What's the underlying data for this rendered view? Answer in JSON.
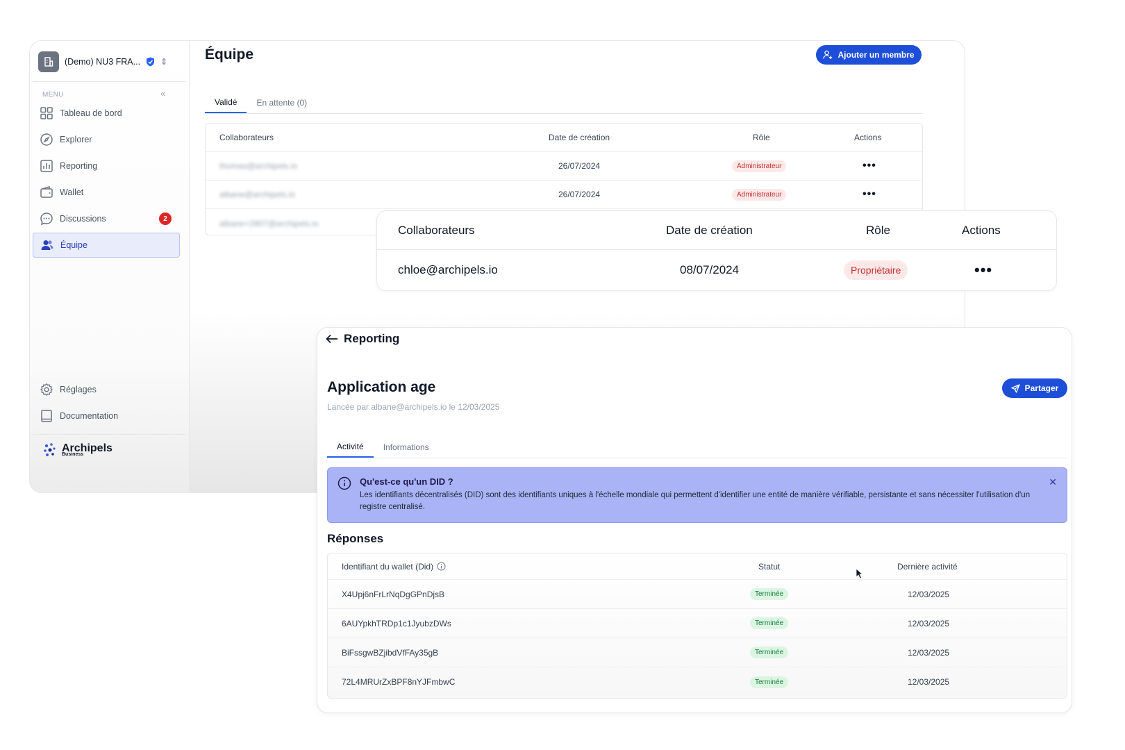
{
  "sidebar": {
    "org_name": "(Demo) NU3 FRA...",
    "menu_label": "MENU",
    "items": [
      {
        "label": "Tableau de bord",
        "icon": "dashboard-icon"
      },
      {
        "label": "Explorer",
        "icon": "compass-icon"
      },
      {
        "label": "Reporting",
        "icon": "chart-icon"
      },
      {
        "label": "Wallet",
        "icon": "wallet-icon"
      },
      {
        "label": "Discussions",
        "icon": "chat-icon",
        "badge": "2"
      },
      {
        "label": "Équipe",
        "icon": "users-icon",
        "active": true
      }
    ],
    "bottom_items": [
      {
        "label": "Réglages",
        "icon": "gear-icon"
      },
      {
        "label": "Documentation",
        "icon": "book-icon"
      }
    ],
    "brand": {
      "name": "Archipels",
      "sub": "Business"
    }
  },
  "team": {
    "title": "Équipe",
    "add_button": "Ajouter un membre",
    "tabs": [
      "Validé",
      "En attente (0)"
    ],
    "columns": [
      "Collaborateurs",
      "Date de création",
      "Rôle",
      "Actions"
    ],
    "rows": [
      {
        "email": "thomas@archipels.io",
        "date": "26/07/2024",
        "role": "Administrateur"
      },
      {
        "email": "albane@archipels.io",
        "date": "26/07/2024",
        "role": "Administrateur"
      },
      {
        "email": "albane+2807@archipels.io",
        "date": "",
        "role": ""
      }
    ]
  },
  "owner_card": {
    "columns": [
      "Collaborateurs",
      "Date de création",
      "Rôle",
      "Actions"
    ],
    "email": "chloe@archipels.io",
    "date": "08/07/2024",
    "role": "Propriétaire"
  },
  "report": {
    "back_label": "Reporting",
    "title": "Application age",
    "subtitle": "Lancée par albane@archipels.io le 12/03/2025",
    "share_button": "Partager",
    "tabs": [
      "Activité",
      "Informations"
    ],
    "info": {
      "title": "Qu'est-ce qu'un DID ?",
      "text": "Les identifiants décentralisés (DID) sont des identifiants uniques à l'échelle mondiale qui permettent d'identifier une entité de manière vérifiable, persistante et sans nécessiter l'utilisation d'un registre centralisé."
    },
    "section_title": "Réponses",
    "columns": [
      "Identifiant du wallet (Did)",
      "Statut",
      "Dernière activité"
    ],
    "rows": [
      {
        "did": "X4Upj6nFrLrNqDgGPnDjsB",
        "status": "Terminée",
        "date": "12/03/2025"
      },
      {
        "did": "6AUYpkhTRDp1c1JyubzDWs",
        "status": "Terminée",
        "date": "12/03/2025"
      },
      {
        "did": "BiFssgwBZjibdVfFAy35gB",
        "status": "Terminée",
        "date": "12/03/2025"
      },
      {
        "did": "72L4MRUrZxBPF8nYJFmbwC",
        "status": "Terminée",
        "date": "12/03/2025"
      }
    ]
  },
  "colors": {
    "accent": "#1d4ed8",
    "danger": "#dc2626",
    "success": "#15803d",
    "info_bg": "#a9b3f5"
  }
}
